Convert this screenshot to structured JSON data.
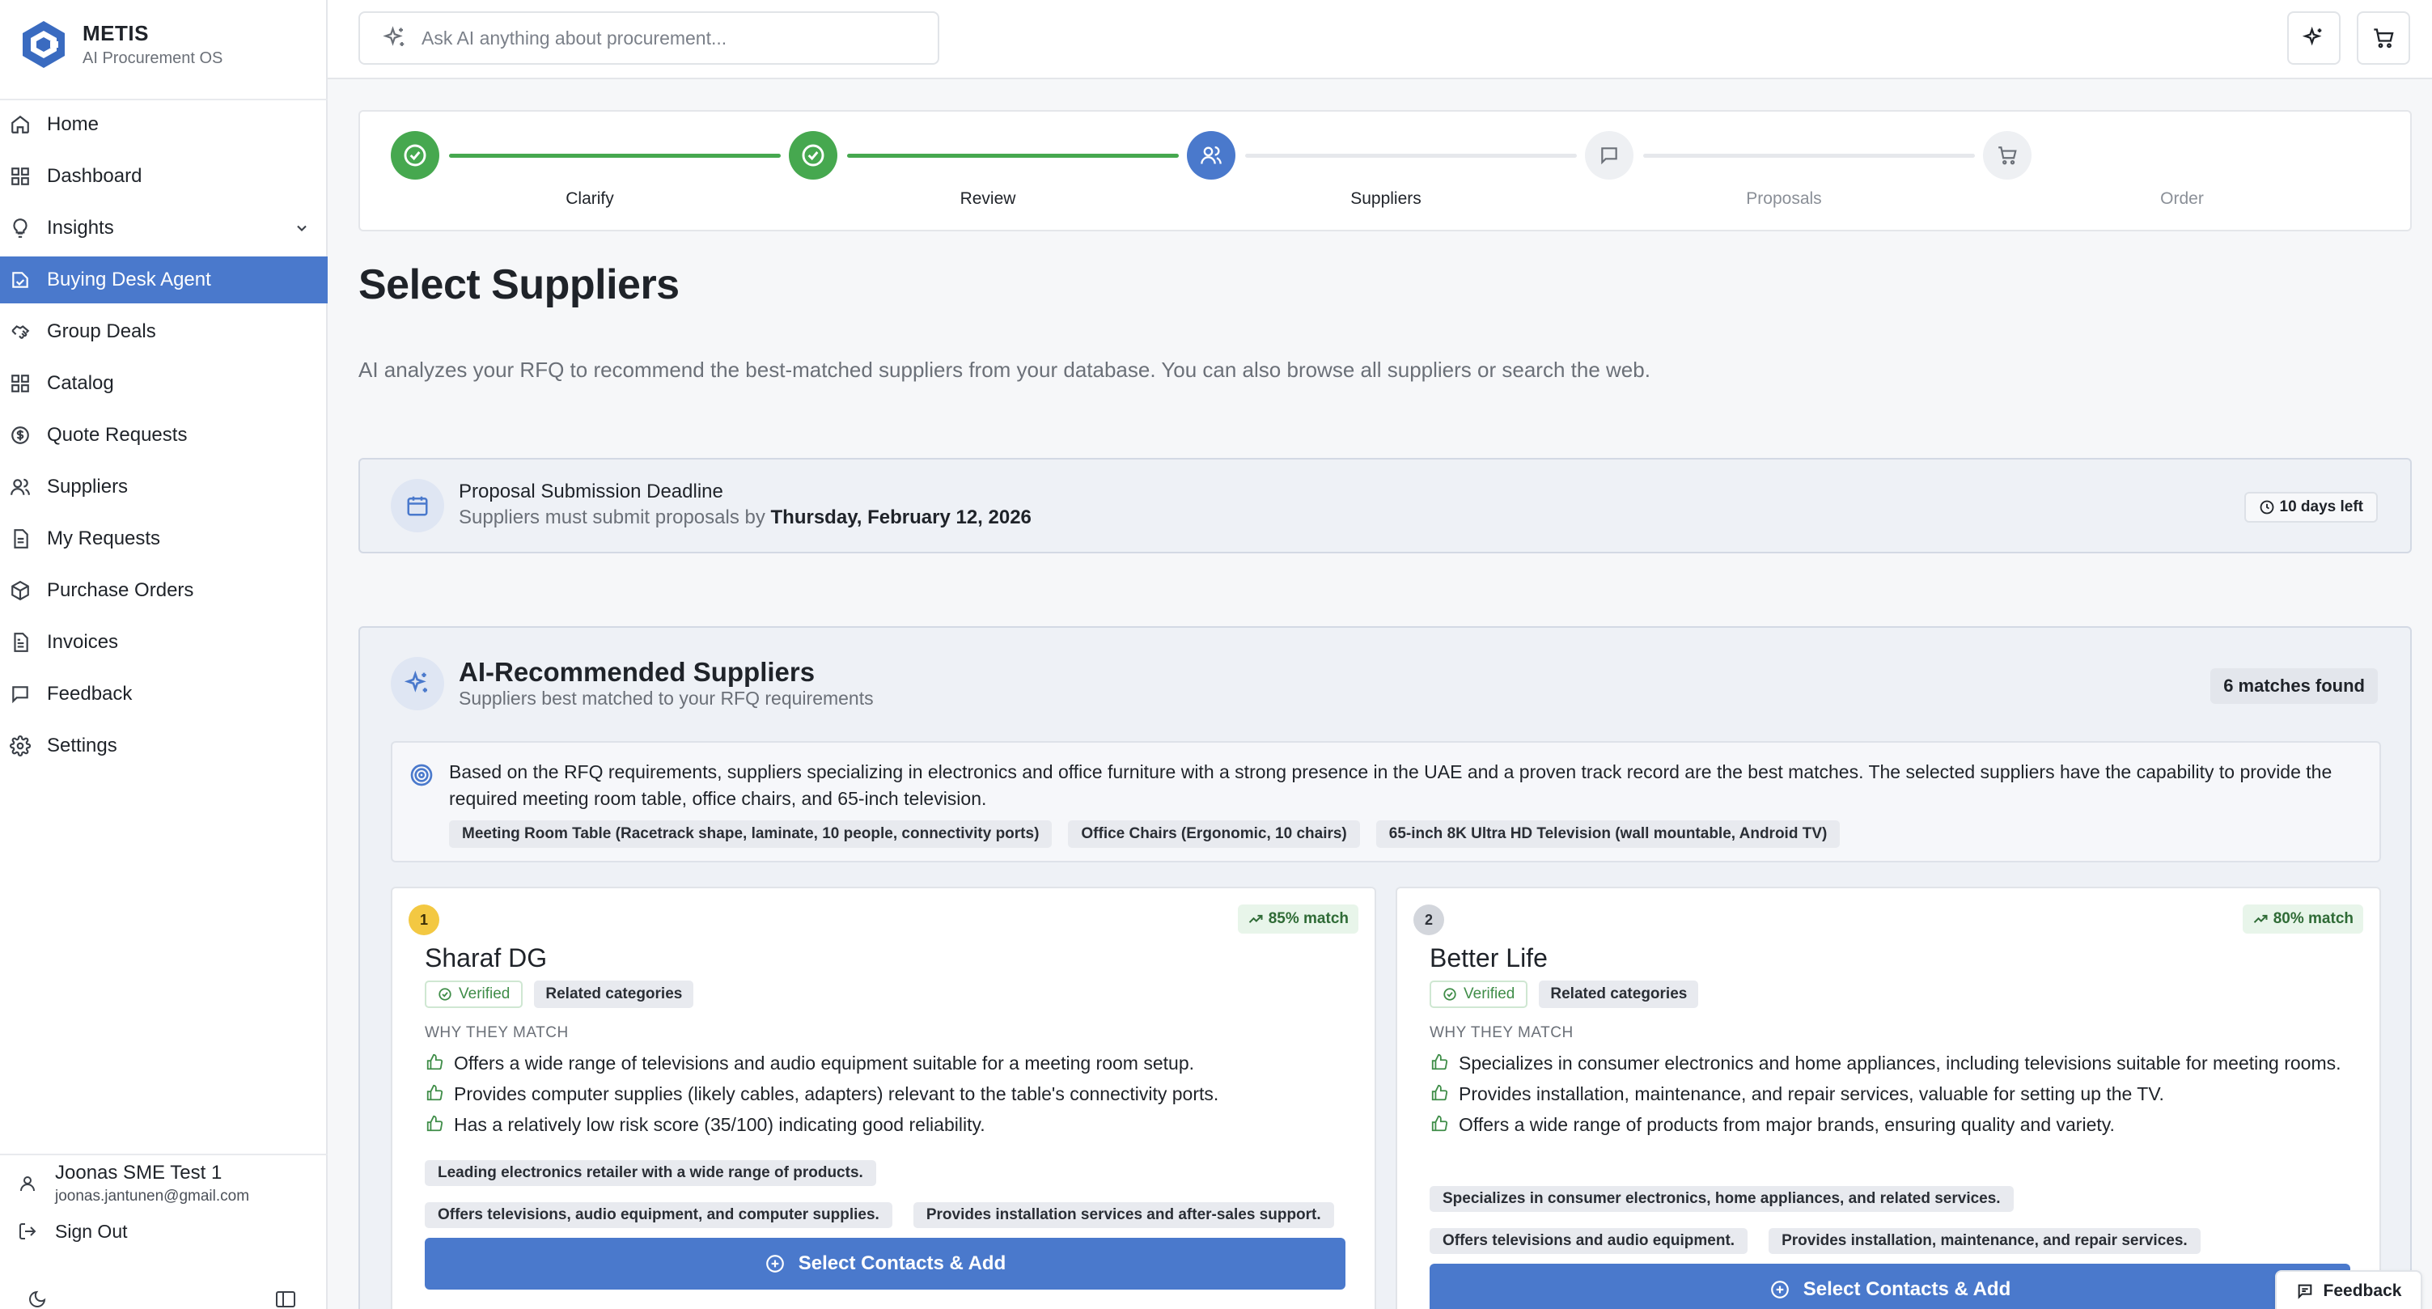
{
  "brand": {
    "name": "METIS",
    "subtitle": "AI Procurement OS"
  },
  "sidebar": {
    "items": [
      {
        "label": "Home",
        "icon": "home-icon"
      },
      {
        "label": "Dashboard",
        "icon": "dashboard-icon"
      },
      {
        "label": "Insights",
        "icon": "lightbulb-icon",
        "expandable": true
      },
      {
        "label": "Buying Desk Agent",
        "icon": "agent-icon",
        "active": true
      },
      {
        "label": "Group Deals",
        "icon": "handshake-icon"
      },
      {
        "label": "Catalog",
        "icon": "grid-icon"
      },
      {
        "label": "Quote Requests",
        "icon": "dollar-icon"
      },
      {
        "label": "Suppliers",
        "icon": "users-icon"
      },
      {
        "label": "My Requests",
        "icon": "document-icon"
      },
      {
        "label": "Purchase Orders",
        "icon": "package-icon"
      },
      {
        "label": "Invoices",
        "icon": "invoice-icon"
      },
      {
        "label": "Feedback",
        "icon": "message-icon"
      },
      {
        "label": "Settings",
        "icon": "gear-icon"
      }
    ],
    "user": {
      "name": "Joonas SME Test 1",
      "email": "joonas.jantunen@gmail.com"
    },
    "sign_out": "Sign Out"
  },
  "topbar": {
    "ask_placeholder": "Ask AI anything about procurement..."
  },
  "stepper": {
    "steps": [
      {
        "label": "Clarify",
        "state": "done"
      },
      {
        "label": "Review",
        "state": "done"
      },
      {
        "label": "Suppliers",
        "state": "current"
      },
      {
        "label": "Proposals",
        "state": "todo"
      },
      {
        "label": "Order",
        "state": "todo"
      }
    ]
  },
  "page": {
    "title": "Select Suppliers",
    "description": "AI analyzes your RFQ to recommend the best-matched suppliers from your database. You can also browse all suppliers or search the web."
  },
  "deadline": {
    "title": "Proposal Submission Deadline",
    "subtitle_prefix": "Suppliers must submit proposals by",
    "date": "Thursday, February 12, 2026",
    "days_left": "10 days left"
  },
  "ai_panel": {
    "title": "AI-Recommended Suppliers",
    "subtitle": "Suppliers best matched to your RFQ requirements",
    "matches": "6 matches found",
    "reasoning": "Based on the RFQ requirements, suppliers specializing in electronics and office furniture with a strong presence in the UAE and a proven track record are the best matches. The selected suppliers have the capability to provide the required meeting room table, office chairs, and 65-inch television.",
    "requirements": [
      "Meeting Room Table (Racetrack shape, laminate, 10 people, connectivity ports)",
      "Office Chairs (Ergonomic, 10 chairs)",
      "65-inch 8K Ultra HD Television (wall mountable, Android TV)"
    ]
  },
  "suppliers": [
    {
      "rank": "1",
      "name": "Sharaf DG",
      "match": "85% match",
      "verified": "Verified",
      "related": "Related categories",
      "why_label": "WHY THEY MATCH",
      "reasons": [
        "Offers a wide range of televisions and audio equipment suitable for a meeting room setup.",
        "Provides computer supplies (likely cables, adapters) relevant to the table's connectivity ports.",
        "Has a relatively low risk score (35/100) indicating good reliability."
      ],
      "highlights": [
        "Leading electronics retailer with a wide range of products.",
        "Offers televisions, audio equipment, and computer supplies.",
        "Provides installation services and after-sales support."
      ],
      "button": "Select Contacts & Add"
    },
    {
      "rank": "2",
      "name": "Better Life",
      "match": "80% match",
      "verified": "Verified",
      "related": "Related categories",
      "why_label": "WHY THEY MATCH",
      "reasons": [
        "Specializes in consumer electronics and home appliances, including televisions suitable for meeting rooms.",
        "Provides installation, maintenance, and repair services, valuable for setting up the TV.",
        "Offers a wide range of products from major brands, ensuring quality and variety."
      ],
      "highlights": [
        "Specializes in consumer electronics, home appliances, and related services.",
        "Offers televisions and audio equipment.",
        "Provides installation, maintenance, and repair services."
      ],
      "button": "Select Contacts & Add"
    }
  ],
  "feedback_fab": "Feedback",
  "colors": {
    "accent": "#4a79cc",
    "success": "#46a84f",
    "rank_gold": "#f3c842"
  }
}
